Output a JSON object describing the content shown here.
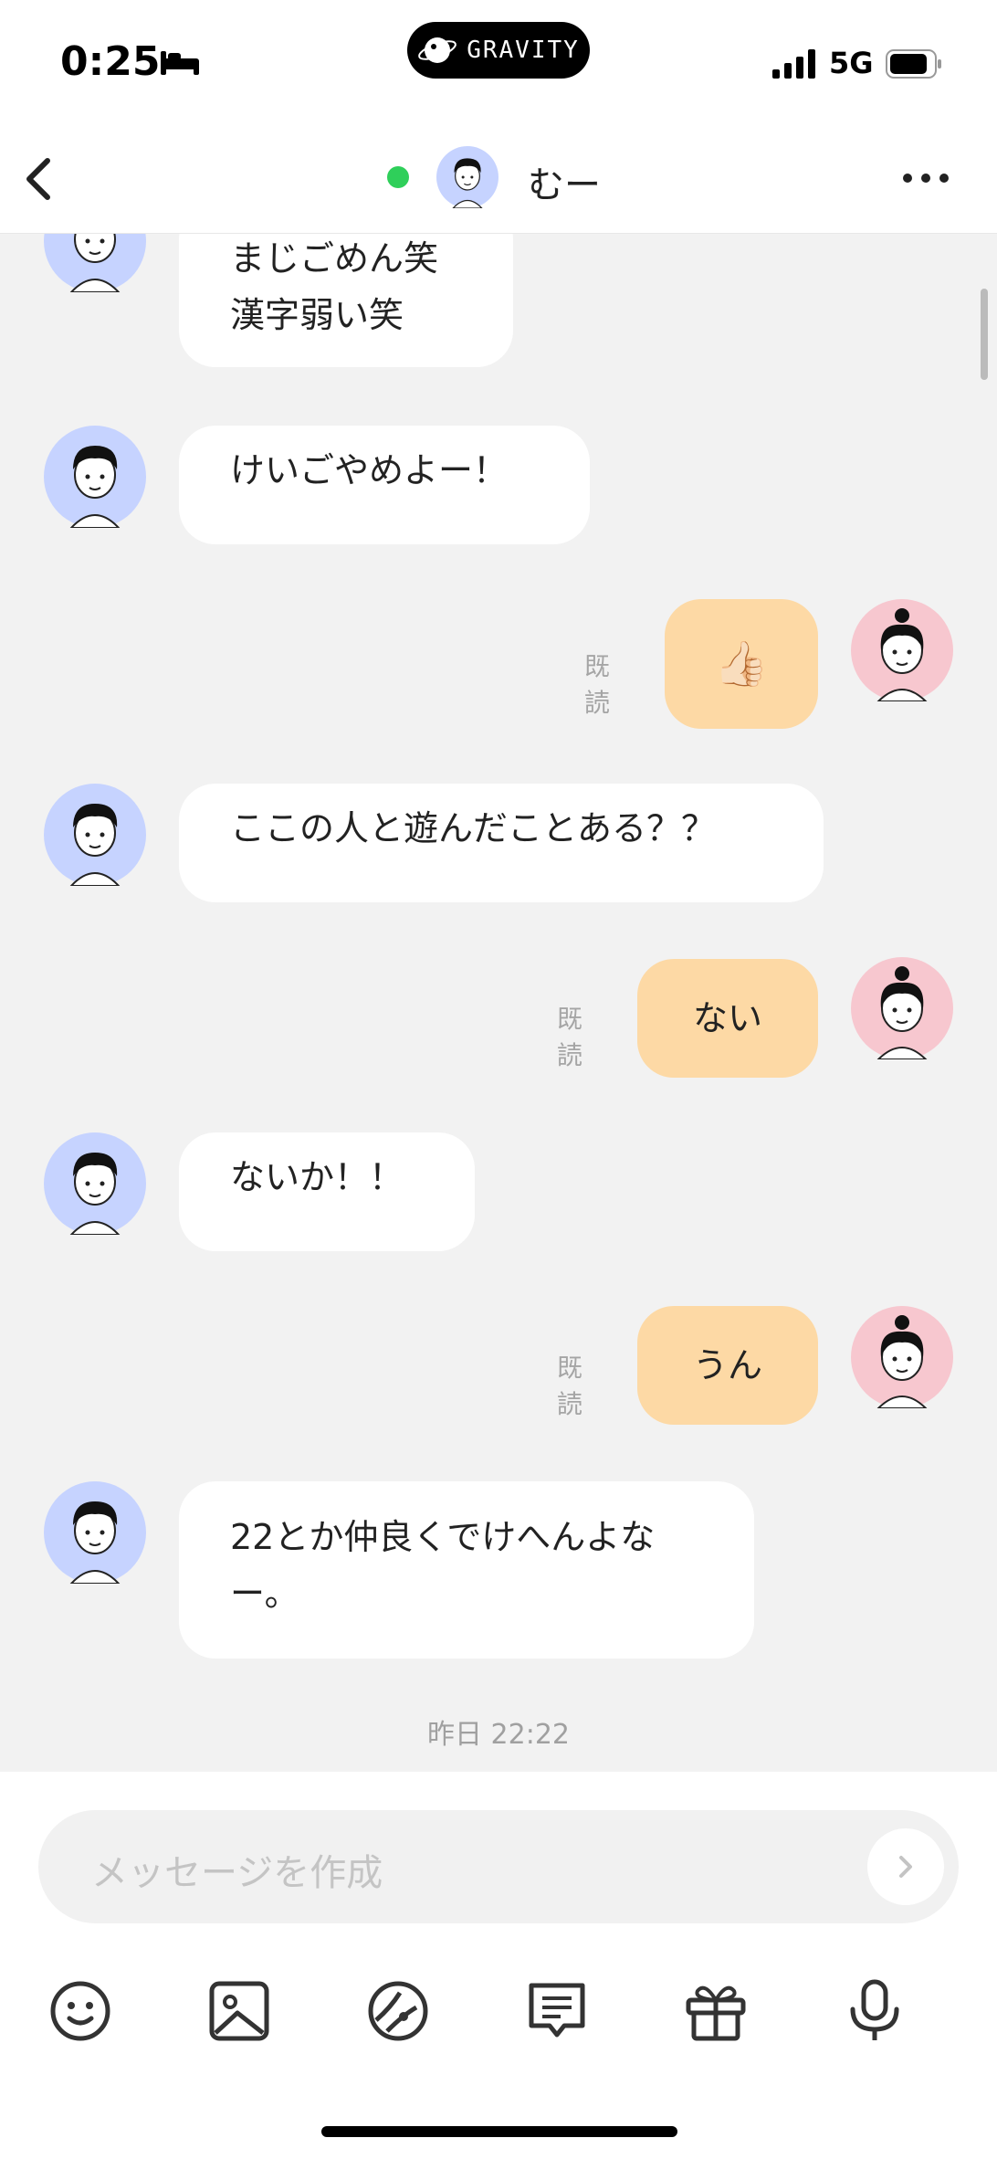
{
  "status_bar": {
    "time": "0:25",
    "island_text": "GRAVITY",
    "network": "5G"
  },
  "header": {
    "name": "むー",
    "online_color": "#2fcf5a"
  },
  "messages": [
    {
      "side": "in",
      "text": "まじごめん笑\n漢字弱い笑"
    },
    {
      "side": "in",
      "text": "けいごやめよー！"
    },
    {
      "side": "out",
      "text": "👍🏻",
      "read_label": "既読"
    },
    {
      "side": "in",
      "text": "ここの人と遊んだことある？？"
    },
    {
      "side": "out",
      "text": "ない",
      "read_label": "既読"
    },
    {
      "side": "in",
      "text": "ないか！！"
    },
    {
      "side": "out",
      "text": "うん",
      "read_label": "既読"
    },
    {
      "side": "in",
      "text": "22とか仲良くでけへんよな\nー。"
    }
  ],
  "date_stamp": "昨日 22:22",
  "composer": {
    "placeholder": "メッセージを作成"
  },
  "toolbar": [
    "smile-icon",
    "image-icon",
    "sticker-icon",
    "template-icon",
    "gift-icon",
    "mic-icon"
  ],
  "colors": {
    "incoming_bubble": "#ffffff",
    "outgoing_bubble": "#fdd9a5",
    "background": "#f2f2f2",
    "male_avatar_bg": "#c6d3ff",
    "female_avatar_bg": "#f7c7cf"
  }
}
